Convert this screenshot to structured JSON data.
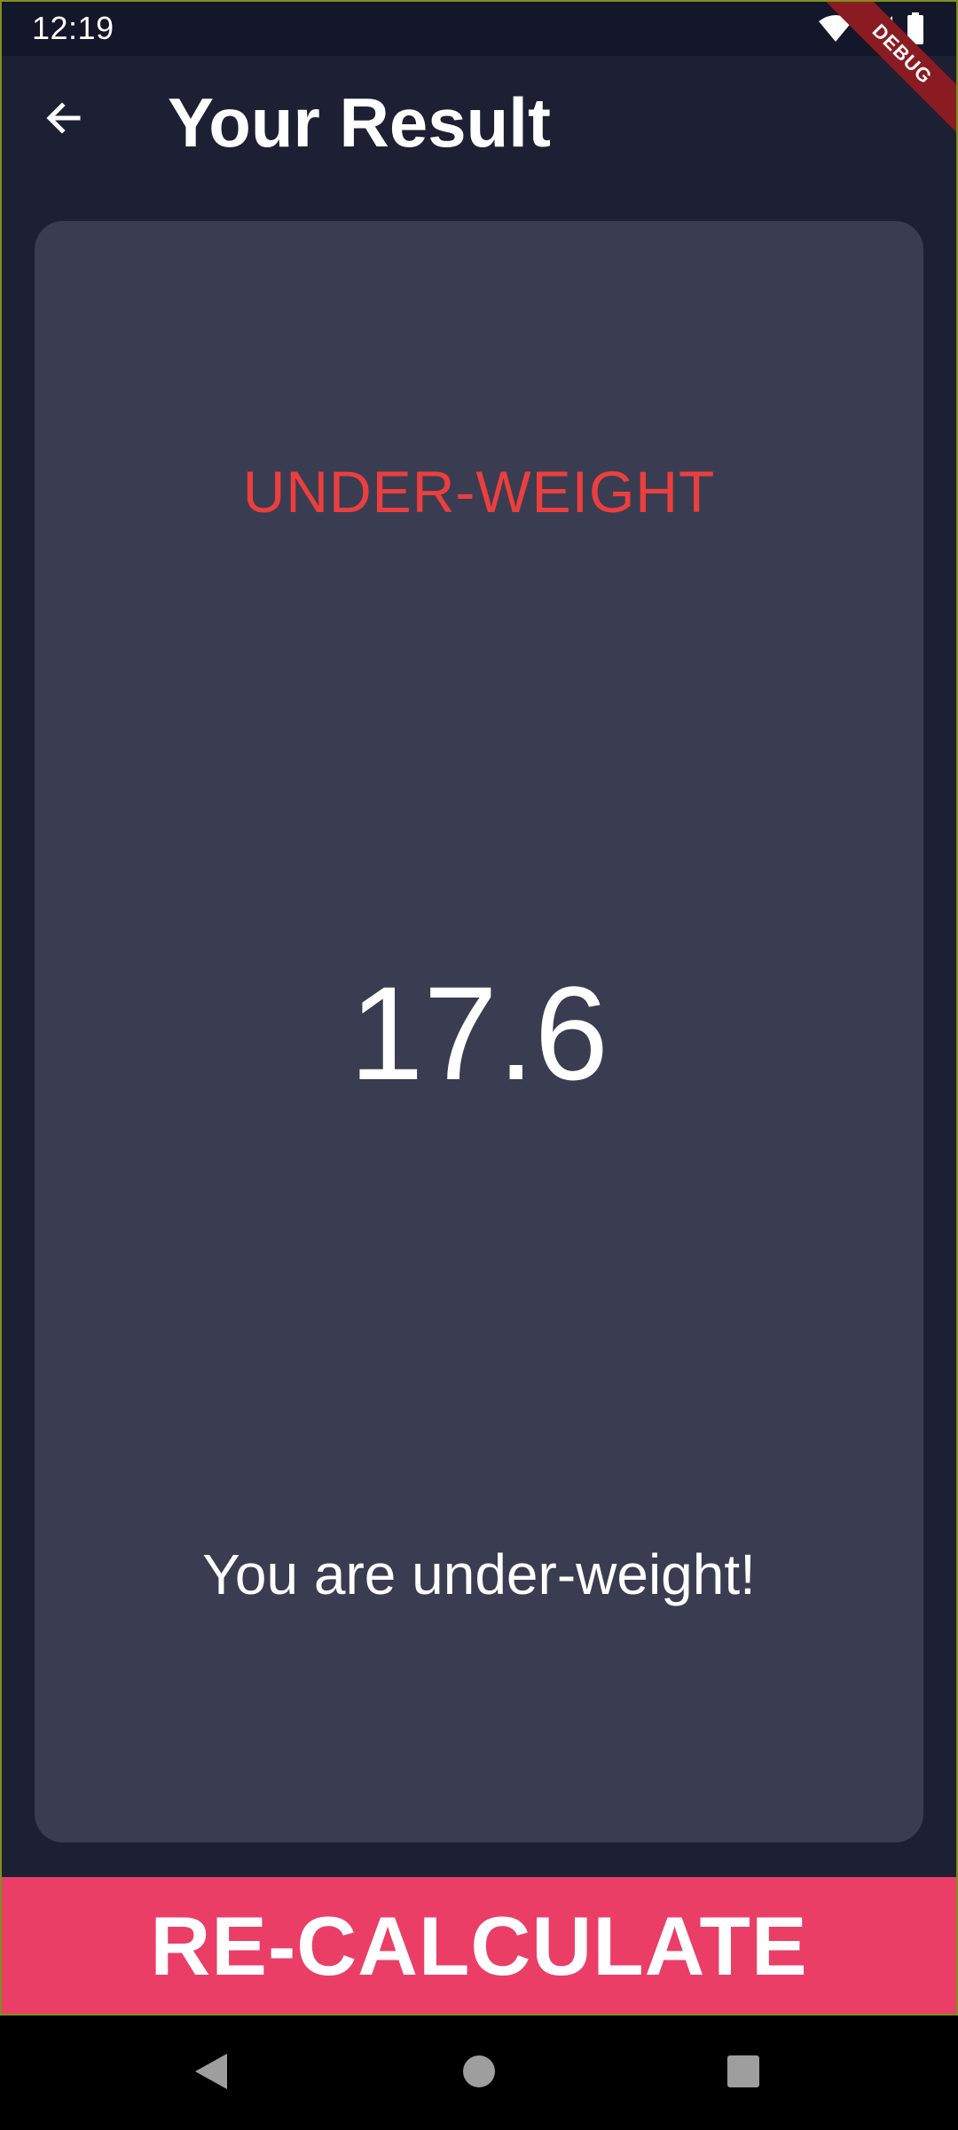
{
  "status_bar": {
    "time": "12:19",
    "icons": [
      "wifi-icon",
      "cellular-signal-icon",
      "battery-icon"
    ]
  },
  "app_bar": {
    "back_icon": "arrow-back-icon",
    "title": "Your Result"
  },
  "debug_banner": {
    "label": "DEBUG"
  },
  "result": {
    "status": "UNDER-WEIGHT",
    "value": "17.6",
    "message": "You are under-weight!"
  },
  "actions": {
    "recalculate_label": "RE-CALCULATE"
  },
  "nav_bar": {
    "icons": [
      "nav-back-icon",
      "nav-home-icon",
      "nav-recents-icon"
    ]
  },
  "colors": {
    "background": "#1d1f33",
    "card": "#3a3d51",
    "status_text": "#ed3e3e",
    "button": "#ea3e67",
    "text": "#ffffff"
  }
}
